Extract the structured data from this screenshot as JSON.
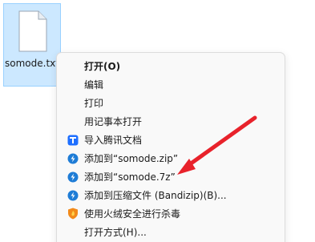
{
  "desktop_file": {
    "name": "somode.txt",
    "selected": true,
    "icon": "text-file-icon"
  },
  "context_menu": {
    "items": [
      {
        "label": "打开(O)",
        "icon": null,
        "default": true
      },
      {
        "label": "编辑",
        "icon": null
      },
      {
        "label": "打印",
        "icon": null
      },
      {
        "label": "用记事本打开",
        "icon": null
      },
      {
        "label": "导入腾讯文档",
        "icon": "tencent-docs-icon"
      },
      {
        "label": "添加到“somode.zip”",
        "icon": "bandizip-icon"
      },
      {
        "label": "添加到“somode.7z”",
        "icon": "bandizip-icon"
      },
      {
        "label": "添加到压缩文件 (Bandizip)(B)...",
        "icon": "bandizip-icon"
      },
      {
        "label": "使用火绒安全进行杀毒",
        "icon": "huorong-shield-icon"
      },
      {
        "label": "打开方式(H)...",
        "icon": null
      }
    ]
  },
  "annotation": {
    "color": "#e8222b",
    "icon": "red-arrow-icon"
  }
}
